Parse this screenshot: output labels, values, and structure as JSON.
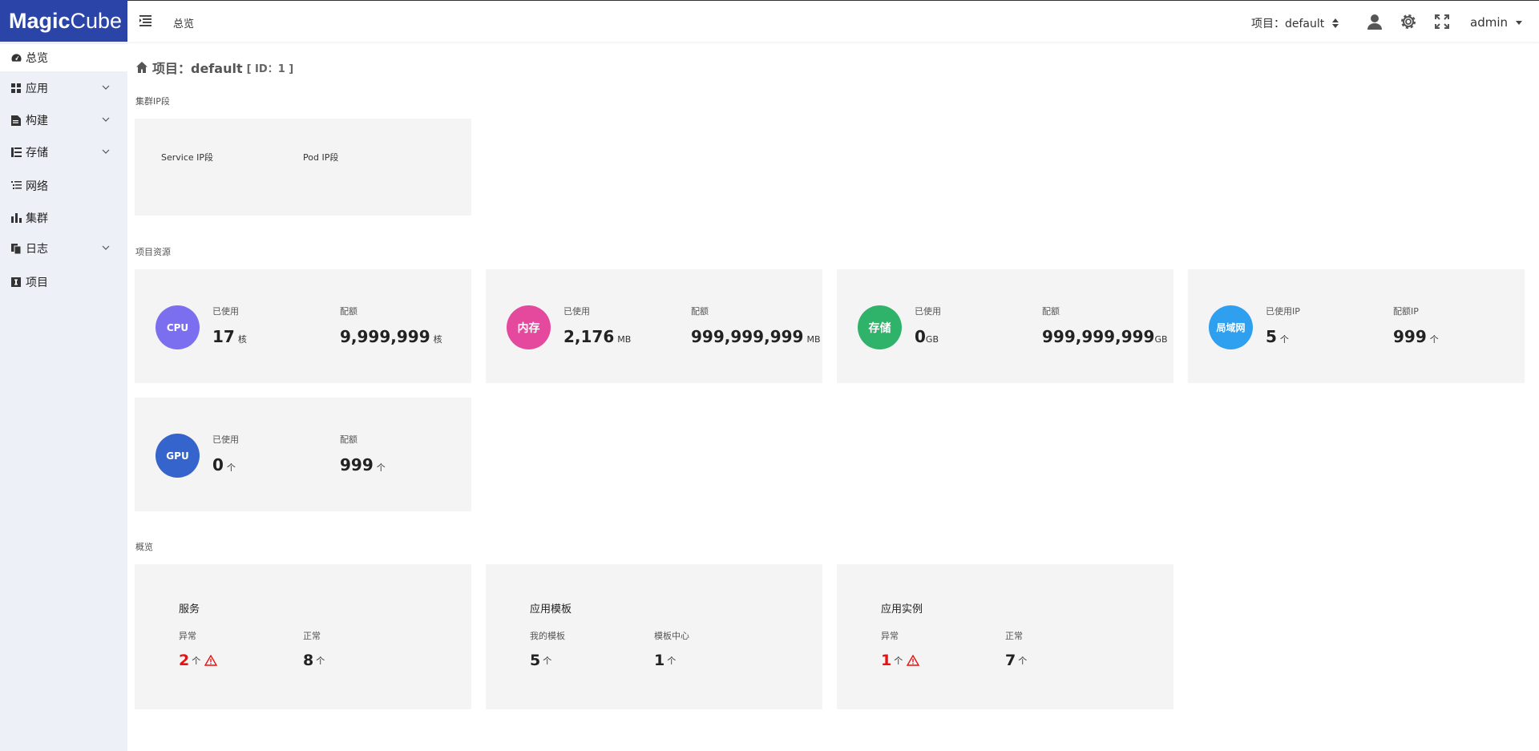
{
  "logo": {
    "bold": "Magic",
    "light": "Cube"
  },
  "sidebar": {
    "items": [
      {
        "label": "总览",
        "icon": "dashboard-icon"
      },
      {
        "label": "应用",
        "icon": "grid-icon"
      },
      {
        "label": "构建",
        "icon": "document-icon"
      },
      {
        "label": "存储",
        "icon": "storage-list-icon"
      },
      {
        "label": "网络",
        "icon": "network-list-icon"
      },
      {
        "label": "集群",
        "icon": "bar-chart-icon"
      },
      {
        "label": "日志",
        "icon": "copy-icon"
      },
      {
        "label": "项目",
        "icon": "info-icon"
      }
    ]
  },
  "topbar": {
    "breadcrumb": "总览",
    "project_select": "项目：default",
    "user": "admin"
  },
  "page": {
    "title": "项目：default",
    "id_text": "[ ID：1 ]"
  },
  "cluster_ip": {
    "section_title": "集群IP段",
    "service_label": "Service IP段",
    "pod_label": "Pod IP段"
  },
  "resources": {
    "section_title": "项目资源",
    "cards": [
      {
        "badge": "CPU",
        "color": "#7b6ff0",
        "used_label": "已使用",
        "used_value": "17",
        "used_unit": "核",
        "quota_label": "配额",
        "quota_value": "9,999,999",
        "quota_unit": "核"
      },
      {
        "badge": "内存",
        "color": "#e4499d",
        "used_label": "已使用",
        "used_value": "2,176",
        "used_unit": "MB",
        "quota_label": "配额",
        "quota_value": "999,999,999",
        "quota_unit": "MB"
      },
      {
        "badge": "存储",
        "color": "#2fb36a",
        "used_label": "已使用",
        "used_value": "0",
        "used_unit": "GB",
        "quota_label": "配额",
        "quota_value": "999,999,999",
        "quota_unit": "GB"
      },
      {
        "badge": "局域网",
        "color": "#2f9ff0",
        "used_label": "已使用IP",
        "used_value": "5",
        "used_unit": "个",
        "quota_label": "配额IP",
        "quota_value": "999",
        "quota_unit": "个"
      },
      {
        "badge": "GPU",
        "color": "#3565cc",
        "used_label": "已使用",
        "used_value": "0",
        "used_unit": "个",
        "quota_label": "配额",
        "quota_value": "999",
        "quota_unit": "个"
      }
    ]
  },
  "overview": {
    "section_title": "概览",
    "cards": [
      {
        "title": "服务",
        "left_label": "异常",
        "left_value": "2",
        "left_unit": "个",
        "right_label": "正常",
        "right_value": "8",
        "right_unit": "个"
      },
      {
        "title": "应用模板",
        "left_label": "我的模板",
        "left_value": "5",
        "left_unit": "个",
        "right_label": "模板中心",
        "right_value": "1",
        "right_unit": "个"
      },
      {
        "title": "应用实例",
        "left_label": "异常",
        "left_value": "1",
        "left_unit": "个",
        "right_label": "正常",
        "right_value": "7",
        "right_unit": "个"
      }
    ]
  },
  "colors": {
    "brand": "#2b44a8",
    "sidebar_bg": "#eef0f8",
    "card_bg": "#f4f4f4",
    "alert": "#e8110f"
  }
}
